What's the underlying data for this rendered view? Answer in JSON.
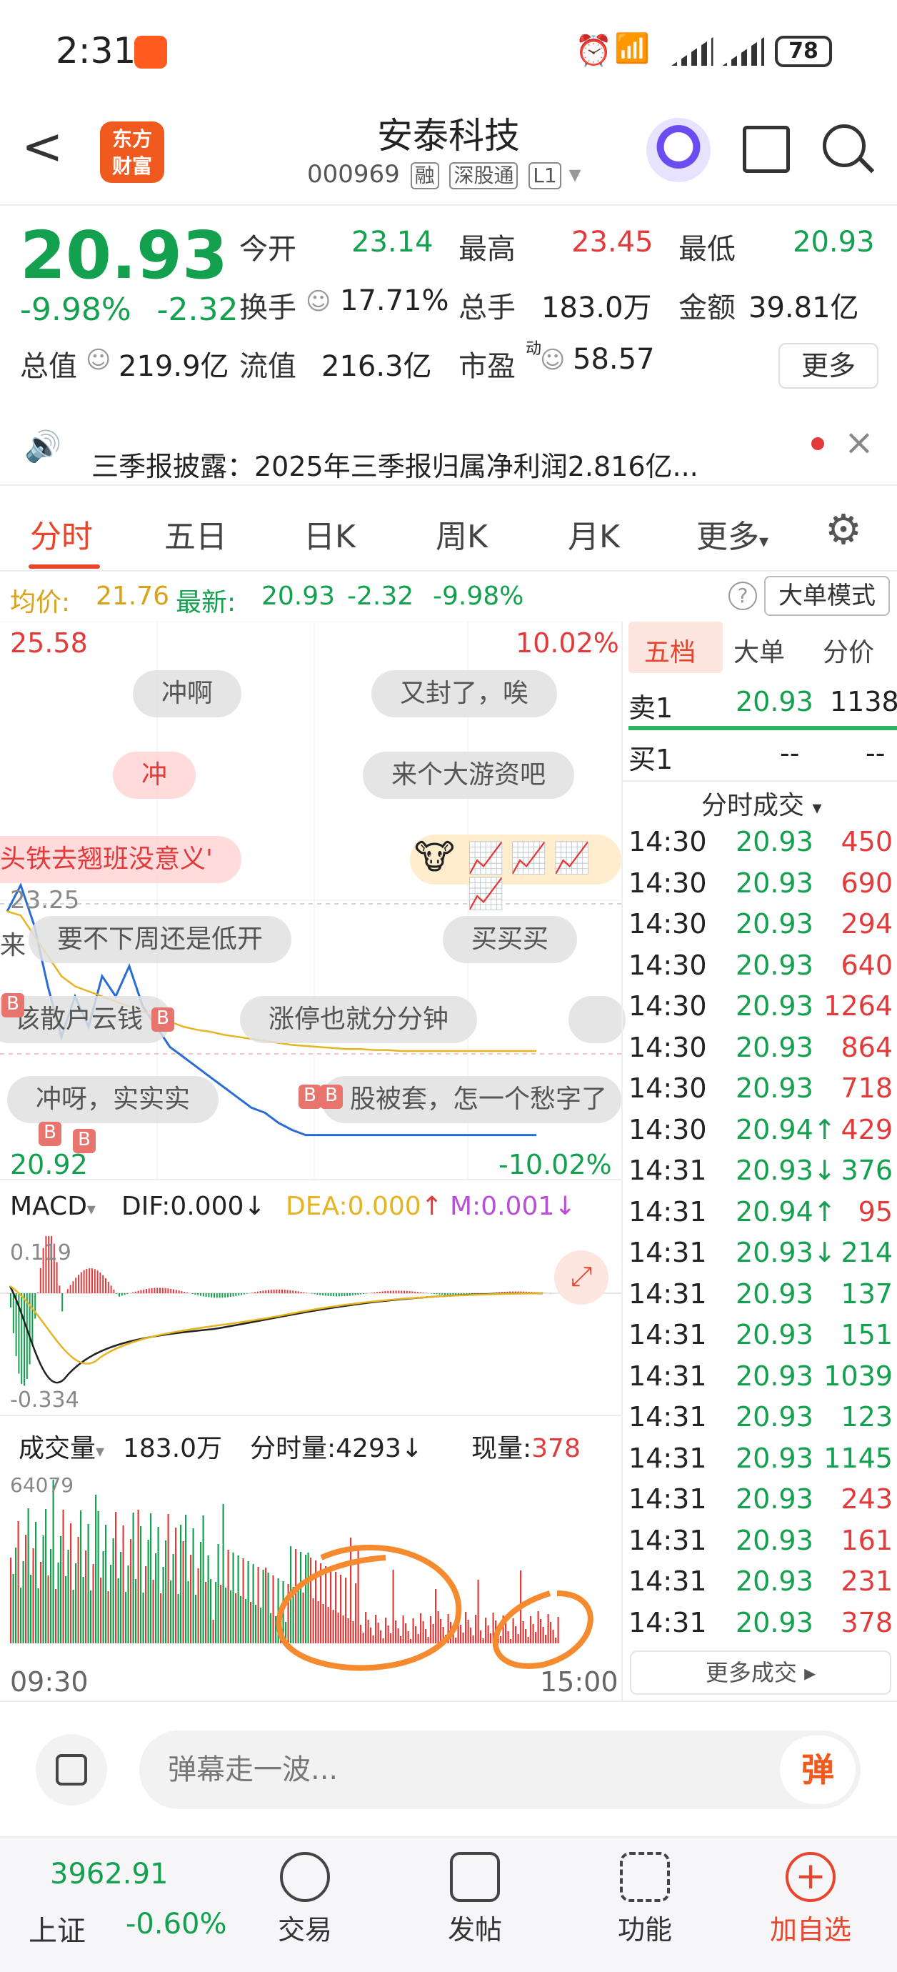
{
  "status": {
    "time": "2:31",
    "battery": "78"
  },
  "header": {
    "logo_line1": "东方",
    "logo_line2": "财富",
    "stock_name": "安泰科技",
    "stock_code": "000969",
    "tags": [
      "融",
      "深股通",
      "L1"
    ]
  },
  "quote": {
    "price": "20.93",
    "change_pct": "-9.98%",
    "change": "-2.32",
    "open_label": "今开",
    "open": "23.14",
    "high_label": "最高",
    "high": "23.45",
    "low_label": "最低",
    "low": "20.93",
    "turnover_label": "换手",
    "turnover": "17.71%",
    "volume_label": "总手",
    "volume": "183.0万",
    "amount_label": "金额",
    "amount": "39.81亿",
    "mcap_label": "总值",
    "mcap": "219.9亿",
    "float_label": "流值",
    "float": "216.3亿",
    "pe_label": "市盈",
    "pe_sup": "动",
    "pe": "58.57",
    "more_label": "更多"
  },
  "news": {
    "text": "三季报披露：2025年三季报归属净利润2.816亿..."
  },
  "tabs": [
    "分时",
    "五日",
    "日K",
    "周K",
    "月K",
    "更多"
  ],
  "avg_bar": {
    "avg_label": "均价:",
    "avg": "21.76",
    "latest_label": "最新:",
    "latest": "20.93",
    "chg": "-2.32",
    "chg_pct": "-9.98%",
    "big_order_mode": "大单模式"
  },
  "chart": {
    "y_top": "25.58",
    "y_top_pct": "10.02%",
    "y_bottom": "20.92",
    "y_bottom_pct": "-10.02%",
    "ref_price": "23.25",
    "time_start": "09:30",
    "time_end": "15:00",
    "macd_label": "MACD",
    "dif": "DIF:0.000",
    "dea": "DEA:0.000",
    "m": "M:0.001",
    "macd_top": "0.119",
    "macd_bottom": "-0.334",
    "vol_label": "成交量",
    "vol_total": "183.0万",
    "vol_tick_label": "分时量:4293",
    "vol_now_label": "现量:",
    "vol_now": "378",
    "vol_max": "64079",
    "danmaku": [
      "冲啊",
      "又封了，唉",
      "冲",
      "来个大游资吧",
      "头铁去翘班没意义'",
      "要不下周还是低开",
      "买买买",
      "涨停也就分分钟",
      "冲呀，实实实",
      "股被套，怎一个愁字了"
    ],
    "danmaku_prefix": [
      "来",
      "该散户云钱"
    ]
  },
  "chart_data": {
    "type": "line",
    "series": [
      {
        "values": [
          23.14,
          23.4,
          23.0,
          22.4,
          21.9,
          22.3,
          22.0,
          22.5,
          22.3,
          22.6,
          22.2,
          22.0,
          21.8,
          21.7,
          21.6,
          21.5,
          21.4,
          21.3,
          21.2,
          21.15,
          21.05,
          20.98,
          20.93,
          20.93,
          20.93,
          20.93,
          20.93,
          20.93,
          20.93,
          20.93,
          20.93,
          20.93,
          20.93,
          20.93,
          20.93,
          20.93,
          20.93,
          20.93,
          20.93,
          20.93
        ]
      },
      {
        "values": [
          23.14,
          23.1,
          22.9,
          22.7,
          22.5,
          22.4,
          22.35,
          22.3,
          22.25,
          22.2,
          22.15,
          22.1,
          22.05,
          22.0,
          21.97,
          21.95,
          21.92,
          21.9,
          21.88,
          21.86,
          21.84,
          21.82,
          21.81,
          21.8,
          21.79,
          21.78,
          21.78,
          21.77,
          21.77,
          21.76,
          21.76,
          21.76,
          21.76,
          21.76,
          21.76,
          21.76,
          21.76,
          21.76,
          21.76,
          21.76
        ]
      }
    ],
    "ylim": [
      20.92,
      25.58
    ]
  },
  "side": {
    "tabs": [
      "五档",
      "大单",
      "分价"
    ],
    "sell1_label": "卖1",
    "sell1_price": "20.93",
    "sell1_vol": "1138",
    "buy1_label": "买1",
    "buy1_price": "--",
    "buy1_vol": "--",
    "trades_title": "分时成交",
    "trades": [
      {
        "t": "14:30",
        "p": "20.93",
        "v": "450",
        "vc": "up"
      },
      {
        "t": "14:30",
        "p": "20.93",
        "v": "690",
        "vc": "up"
      },
      {
        "t": "14:30",
        "p": "20.93",
        "v": "294",
        "vc": "up"
      },
      {
        "t": "14:30",
        "p": "20.93",
        "v": "640",
        "vc": "up"
      },
      {
        "t": "14:30",
        "p": "20.93",
        "v": "1264",
        "vc": "up"
      },
      {
        "t": "14:30",
        "p": "20.93",
        "v": "864",
        "vc": "up"
      },
      {
        "t": "14:30",
        "p": "20.93",
        "v": "718",
        "vc": "up"
      },
      {
        "t": "14:30",
        "p": "20.94↑",
        "v": "429",
        "vc": "up"
      },
      {
        "t": "14:31",
        "p": "20.93↓",
        "v": "376",
        "vc": "dn"
      },
      {
        "t": "14:31",
        "p": "20.94↑",
        "v": "95",
        "vc": "up"
      },
      {
        "t": "14:31",
        "p": "20.93↓",
        "v": "214",
        "vc": "dn"
      },
      {
        "t": "14:31",
        "p": "20.93",
        "v": "137",
        "vc": "dn"
      },
      {
        "t": "14:31",
        "p": "20.93",
        "v": "151",
        "vc": "dn"
      },
      {
        "t": "14:31",
        "p": "20.93",
        "v": "1039",
        "vc": "dn"
      },
      {
        "t": "14:31",
        "p": "20.93",
        "v": "123",
        "vc": "dn"
      },
      {
        "t": "14:31",
        "p": "20.93",
        "v": "1145",
        "vc": "dn"
      },
      {
        "t": "14:31",
        "p": "20.93",
        "v": "243",
        "vc": "up"
      },
      {
        "t": "14:31",
        "p": "20.93",
        "v": "161",
        "vc": "up"
      },
      {
        "t": "14:31",
        "p": "20.93",
        "v": "231",
        "vc": "up"
      },
      {
        "t": "14:31",
        "p": "20.93",
        "v": "378",
        "vc": "up"
      }
    ],
    "more_trades": "更多成交"
  },
  "comment": {
    "placeholder": "弹幕走一波...",
    "dan": "弹"
  },
  "bottom": {
    "index_value": "3962.91",
    "index_name": "上证",
    "index_chg": "-0.60%",
    "nav": [
      "交易",
      "发帖",
      "功能",
      "加自选"
    ]
  },
  "colors": {
    "up": "#e23b3b",
    "down": "#14a14f",
    "accent": "#e8452c",
    "avg": "#e6b422"
  }
}
